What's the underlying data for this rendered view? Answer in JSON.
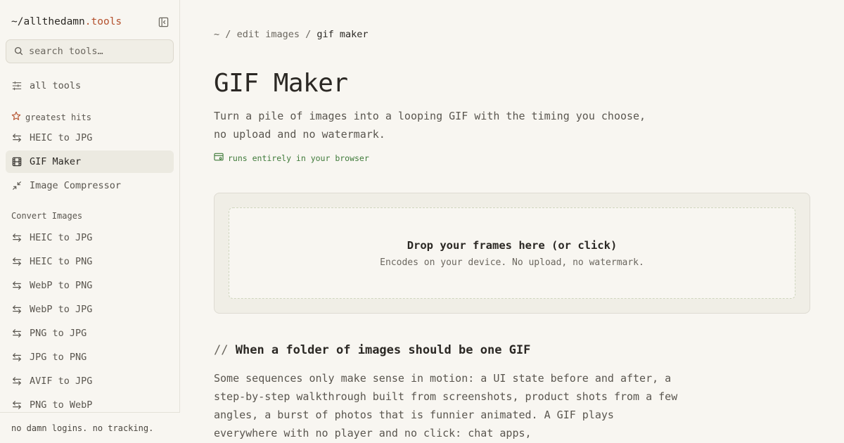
{
  "brand": {
    "prefix": "~/",
    "name": "allthedamn",
    "suffix": ".tools"
  },
  "search": {
    "placeholder": "search tools…"
  },
  "sidebar": {
    "all_tools": "all tools",
    "greatest_hits_label": "greatest hits",
    "greatest_hits": [
      {
        "label": "HEIC to JPG",
        "icon": "arrows-swap-icon"
      },
      {
        "label": "GIF Maker",
        "icon": "film-icon",
        "active": true
      },
      {
        "label": "Image Compressor",
        "icon": "compress-icon"
      }
    ],
    "convert_label": "Convert Images",
    "convert_items": [
      {
        "label": "HEIC to JPG"
      },
      {
        "label": "HEIC to PNG"
      },
      {
        "label": "WebP to PNG"
      },
      {
        "label": "WebP to JPG"
      },
      {
        "label": "PNG to JPG"
      },
      {
        "label": "JPG to PNG"
      },
      {
        "label": "AVIF to JPG"
      },
      {
        "label": "PNG to WebP"
      }
    ],
    "footer": "no damn logins. no tracking."
  },
  "breadcrumb": {
    "home": "~",
    "sep": "/",
    "parent": "edit images",
    "current": "gif maker"
  },
  "page": {
    "title": "GIF Maker",
    "lede": "Turn a pile of images into a looping GIF with the timing you choose, no upload and no watermark.",
    "badge": "runs entirely in your browser"
  },
  "dropzone": {
    "title": "Drop your frames here (or click)",
    "subtitle": "Encodes on your device. No upload, no watermark."
  },
  "section": {
    "slashes": "//",
    "heading": "When a folder of images should be one GIF",
    "body": "Some sequences only make sense in motion: a UI state before and after, a step-by-step walkthrough built from screenshots, product shots from a few angles, a burst of photos that is funnier animated. A GIF plays everywhere with no player and no click: chat apps,"
  },
  "colors": {
    "accent": "#b4502c",
    "success": "#3f7a3a",
    "background": "#f8f6f1"
  }
}
